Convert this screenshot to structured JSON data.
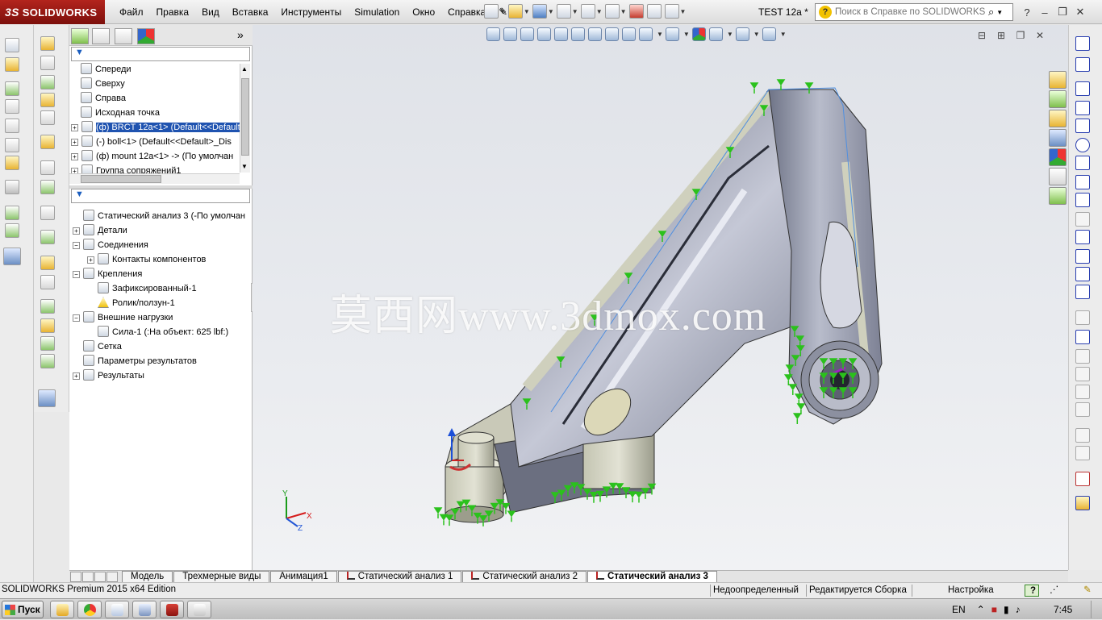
{
  "app": {
    "brand": "SOLIDWORKS",
    "document_title": "TEST 12a *",
    "menu": [
      "Файл",
      "Правка",
      "Вид",
      "Вставка",
      "Инструменты",
      "Simulation",
      "Окно",
      "Справка"
    ],
    "search_placeholder": "Поиск в Справке по SOLIDWORKS",
    "window_controls": [
      "?",
      "–",
      "❐",
      "✕"
    ]
  },
  "feature_tree_top": {
    "items": [
      {
        "label": "Спереди",
        "icon": "plane-icon"
      },
      {
        "label": "Сверху",
        "icon": "plane-icon"
      },
      {
        "label": "Справа",
        "icon": "plane-icon"
      },
      {
        "label": "Исходная точка",
        "icon": "origin-icon"
      },
      {
        "label": "(ф) BRCT 12a<1> (Default<<Default",
        "icon": "part-icon",
        "selected": true
      },
      {
        "label": "(-) boll<1> (Default<<Default>_Dis",
        "icon": "part-icon"
      },
      {
        "label": "(ф) mount 12a<1> -> (По умолчан",
        "icon": "part-icon"
      },
      {
        "label": "Группа сопряжений1",
        "icon": "mates-icon"
      }
    ]
  },
  "simulation_tree": {
    "items": [
      {
        "label": "Статический анализ 3 (-По умолчан",
        "icon": "study-icon",
        "level": 0
      },
      {
        "label": "Детали",
        "icon": "parts-icon",
        "level": 0,
        "expander": "+"
      },
      {
        "label": "Соединения",
        "icon": "connections-icon",
        "level": 0,
        "expander": "−"
      },
      {
        "label": "Контакты компонентов",
        "icon": "contacts-icon",
        "level": 1,
        "expander": "+"
      },
      {
        "label": "Крепления",
        "icon": "fixtures-icon",
        "level": 0,
        "expander": "−"
      },
      {
        "label": "Зафиксированный-1",
        "icon": "fixed-icon",
        "level": 1
      },
      {
        "label": "Ролик/ползун-1",
        "icon": "warning-icon",
        "level": 1
      },
      {
        "label": "Внешние нагрузки",
        "icon": "loads-icon",
        "level": 0,
        "expander": "−"
      },
      {
        "label": "Сила-1 (:На объект: 625 lbf:)",
        "icon": "force-icon",
        "level": 1
      },
      {
        "label": "Сетка",
        "icon": "mesh-icon",
        "level": 0
      },
      {
        "label": "Параметры результатов",
        "icon": "result-options-icon",
        "level": 0
      },
      {
        "label": "Результаты",
        "icon": "results-icon",
        "level": 0,
        "expander": "+"
      }
    ]
  },
  "viewport": {
    "watermark": "莫西网www.3dmox.com",
    "triad": {
      "x": "X",
      "y": "Y",
      "z": "Z"
    },
    "view_controls": [
      "⊟",
      "⊞",
      "❐",
      "✕"
    ]
  },
  "bottom_tabs": [
    {
      "label": "Модель",
      "active": false,
      "study": false
    },
    {
      "label": "Трехмерные виды",
      "active": false,
      "study": false
    },
    {
      "label": "Анимация1",
      "active": false,
      "study": false
    },
    {
      "label": "Статический анализ 1",
      "active": false,
      "study": true
    },
    {
      "label": "Статический анализ 2",
      "active": false,
      "study": true
    },
    {
      "label": "Статический анализ 3",
      "active": true,
      "study": true
    }
  ],
  "status_bar": {
    "edition": "SOLIDWORKS Premium 2015 x64 Edition",
    "definition": "Недоопределенный",
    "mode": "Редактируется Сборка",
    "custom": "Настройка",
    "help": "?"
  },
  "taskbar": {
    "start": "Пуск",
    "lang": "EN",
    "time": "7:45"
  },
  "colors": {
    "part_body": "#9ea3b4",
    "part_face": "#cfd0bd",
    "fixture_green": "#2bc11c",
    "selection": "#1f53b0",
    "brand_red": "#a41c16"
  }
}
